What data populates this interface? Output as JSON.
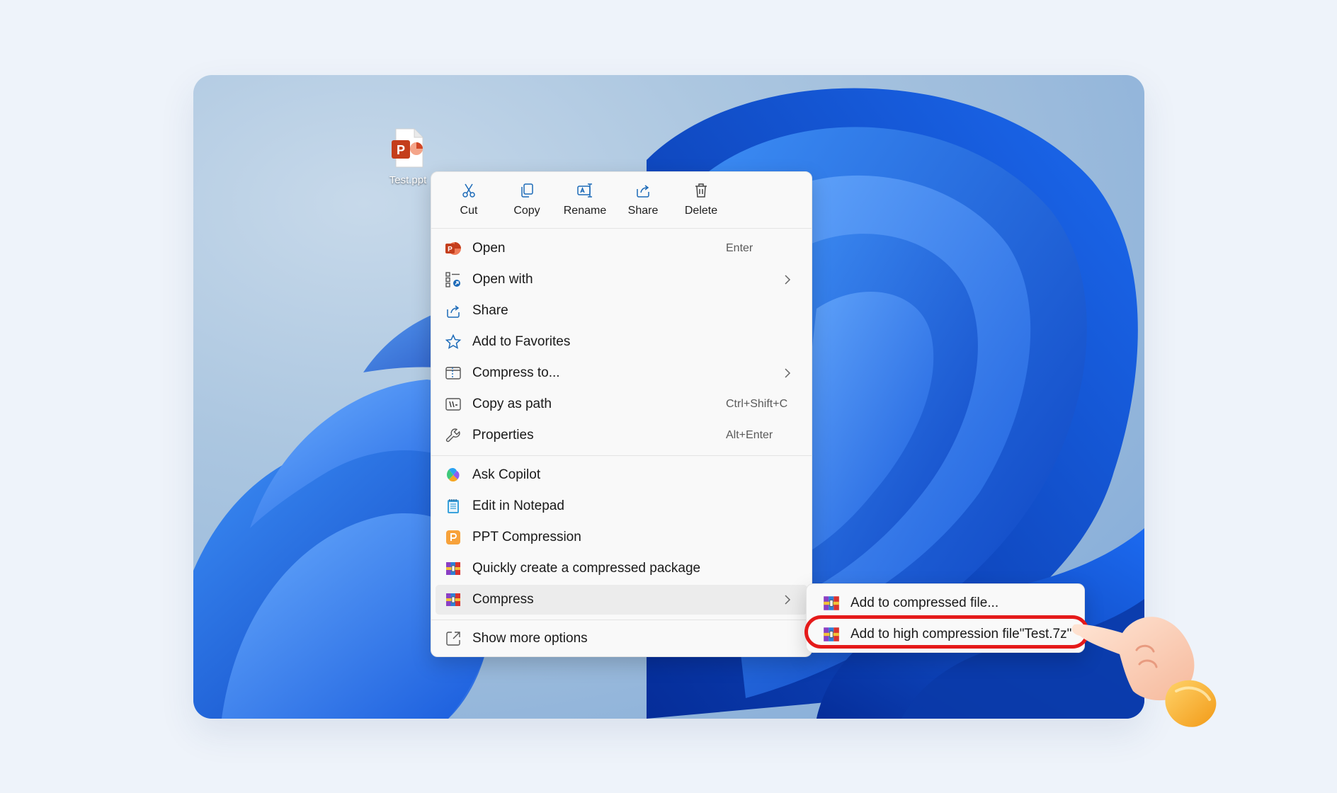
{
  "desktop": {
    "file": {
      "name": "Test.pptx",
      "display_label": "Test.ppt",
      "icon": "powerpoint-file-icon"
    }
  },
  "context_menu": {
    "toolbar": [
      {
        "label": "Cut",
        "icon": "scissors-icon"
      },
      {
        "label": "Copy",
        "icon": "copy-icon"
      },
      {
        "label": "Rename",
        "icon": "rename-icon"
      },
      {
        "label": "Share",
        "icon": "share-icon"
      },
      {
        "label": "Delete",
        "icon": "trash-icon"
      }
    ],
    "items": [
      {
        "label": "Open",
        "shortcut": "Enter",
        "icon": "powerpoint-icon"
      },
      {
        "label": "Open with",
        "submenu": true,
        "icon": "open-with-icon"
      },
      {
        "label": "Share",
        "icon": "share-icon"
      },
      {
        "label": "Add to Favorites",
        "icon": "star-icon"
      },
      {
        "label": "Compress to...",
        "submenu": true,
        "icon": "zip-folder-icon"
      },
      {
        "label": "Copy as path",
        "shortcut": "Ctrl+Shift+C",
        "icon": "path-icon"
      },
      {
        "label": "Properties",
        "shortcut": "Alt+Enter",
        "icon": "wrench-icon"
      },
      {
        "label": "Ask Copilot",
        "icon": "copilot-icon"
      },
      {
        "label": "Edit in Notepad",
        "icon": "notepad-icon"
      },
      {
        "label": "PPT Compression",
        "icon": "ppt-compression-icon"
      },
      {
        "label": "Quickly create a compressed package",
        "icon": "archive-icon"
      },
      {
        "label": "Compress",
        "submenu": true,
        "icon": "archive-icon",
        "hovered": true
      },
      {
        "label": "Show more options",
        "icon": "more-options-icon"
      }
    ]
  },
  "submenu": {
    "items": [
      {
        "label": "Add to compressed file...",
        "icon": "archive-icon"
      },
      {
        "label": "Add to high compression file\"Test.7z\"",
        "icon": "archive-icon",
        "highlighted": true
      }
    ]
  },
  "colors": {
    "accent": "#0f6cbd",
    "highlight_ring": "#e51a1a",
    "menu_bg": "#f9f9f9"
  }
}
